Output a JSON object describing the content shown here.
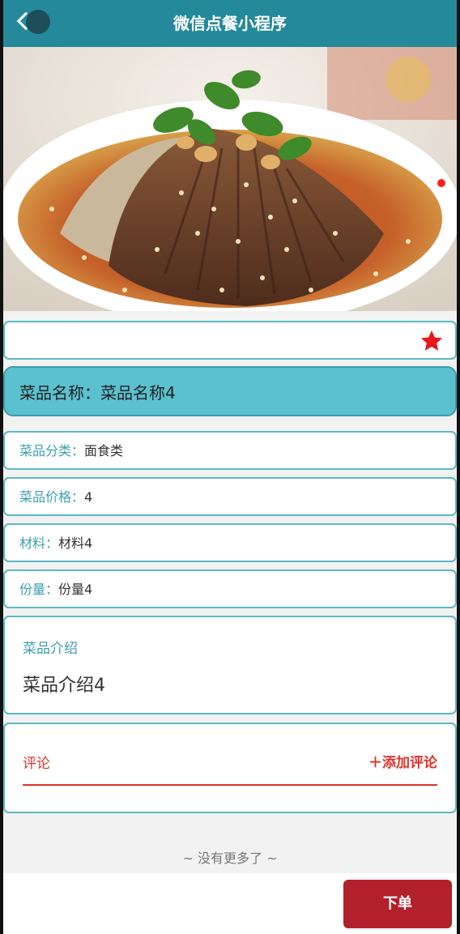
{
  "header": {
    "title": "微信点餐小程序"
  },
  "dish": {
    "name_label": "菜品名称：",
    "name_value": "菜品名称4",
    "fields": [
      {
        "label": "菜品分类：",
        "value": "面食类"
      },
      {
        "label": "菜品价格：",
        "value": "4"
      },
      {
        "label": "材料：",
        "value": "材料4"
      },
      {
        "label": "份量：",
        "value": "份量4"
      }
    ],
    "intro_label": "菜品介绍",
    "intro_value": "菜品介绍4"
  },
  "comments": {
    "label": "评论",
    "add_label": "＋添加评论",
    "empty_text": "~ 没有更多了 ~"
  },
  "actions": {
    "order_label": "下单"
  },
  "colors": {
    "header": "#24899a",
    "accent": "#5bc0cf",
    "order": "#b2202b",
    "favorite": "#e0322a"
  },
  "icons": {
    "back": "chevron-left-icon",
    "favorite": "star-icon"
  }
}
